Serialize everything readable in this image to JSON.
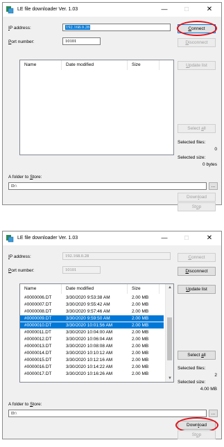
{
  "window_title": "LE file downloader Ver. 1.03",
  "titlebar": {
    "minimize": "—",
    "maximize": "☐",
    "close": "✕"
  },
  "labels": {
    "ip_key": "I",
    "ip_rest": "P address:",
    "port_key": "P",
    "port_rest": "ort number:",
    "folder_pre": "A folder to ",
    "folder_key": "S",
    "folder_rest": "tore:",
    "selected_files": "Selected files:",
    "selected_size": "Selected size:"
  },
  "columns": [
    "Name",
    "Date modified",
    "Size"
  ],
  "buttons": {
    "connect_key": "C",
    "connect_rest": "onnect",
    "disconnect_key": "D",
    "disconnect_rest": "isconnect",
    "update_key": "U",
    "update_rest": "pdate list",
    "selectall_pre": "Select ",
    "selectall_key": "a",
    "selectall_rest": "ll",
    "download_pre": "Down",
    "download_key": "l",
    "download_rest": "oad",
    "stop_pre": "St",
    "stop_key": "o",
    "stop_rest": "p",
    "browse": "..."
  },
  "state1": {
    "ip": "192.168.0.28",
    "port": "10101",
    "folder": "D:\\",
    "selected_files": "0",
    "selected_size": "0 bytes"
  },
  "state2": {
    "ip": "192.168.0.28",
    "port": "10101",
    "folder": "D:\\",
    "selected_files": "2",
    "selected_size": "4.00 MB"
  },
  "files": [
    {
      "name": "#0000006.DT",
      "date": "3/30/2020 9:53:38 AM",
      "size": "2.00 MB",
      "selected": false
    },
    {
      "name": "#0000007.DT",
      "date": "3/30/2020 9:55:42 AM",
      "size": "2.00 MB",
      "selected": false
    },
    {
      "name": "#0000008.DT",
      "date": "3/30/2020 9:57:46 AM",
      "size": "2.00 MB",
      "selected": false
    },
    {
      "name": "#0000009.DT",
      "date": "3/30/2020 9:59:50 AM",
      "size": "2.00 MB",
      "selected": true
    },
    {
      "name": "#0000010.DT",
      "date": "3/30/2020 10:01:56 AM",
      "size": "2.00 MB",
      "selected": true
    },
    {
      "name": "#0000011.DT",
      "date": "3/30/2020 10:04:00 AM",
      "size": "2.00 MB",
      "selected": false
    },
    {
      "name": "#0000012.DT",
      "date": "3/30/2020 10:06:04 AM",
      "size": "2.00 MB",
      "selected": false
    },
    {
      "name": "#0000013.DT",
      "date": "3/30/2020 10:08:08 AM",
      "size": "2.00 MB",
      "selected": false
    },
    {
      "name": "#0000014.DT",
      "date": "3/30/2020 10:10:12 AM",
      "size": "2.00 MB",
      "selected": false
    },
    {
      "name": "#0000015.DT",
      "date": "3/30/2020 10:12:16 AM",
      "size": "2.00 MB",
      "selected": false
    },
    {
      "name": "#0000016.DT",
      "date": "3/30/2020 10:14:22 AM",
      "size": "2.00 MB",
      "selected": false
    },
    {
      "name": "#0000017.DT",
      "date": "3/30/2020 10:16:26 AM",
      "size": "2.00 MB",
      "selected": false
    }
  ],
  "icons": {
    "app": "app-icon",
    "scroll_up": "chevron-up-icon",
    "scroll_down": "chevron-down-icon"
  },
  "colors": {
    "highlight_circle": "#e0101a",
    "selection": "#0078d7"
  }
}
